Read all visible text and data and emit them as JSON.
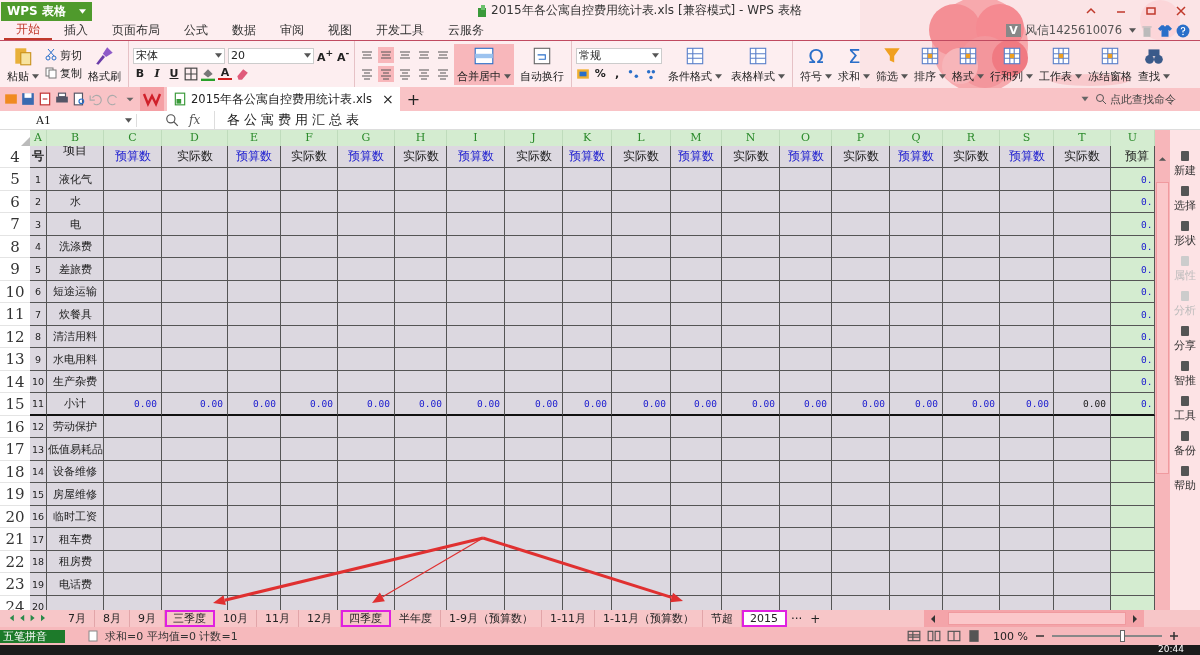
{
  "title_bar": {
    "app_menu": "WPS 表格",
    "document_title": "2015年各公寓自控费用统计表.xls [兼容模式] - WPS 表格",
    "account_badge": "V",
    "account": "风信1425610076"
  },
  "menu_tabs": [
    {
      "label": "开始",
      "selected": true
    },
    {
      "label": "插入",
      "selected": false
    },
    {
      "label": "页面布局",
      "selected": false
    },
    {
      "label": "公式",
      "selected": false
    },
    {
      "label": "数据",
      "selected": false
    },
    {
      "label": "审阅",
      "selected": false
    },
    {
      "label": "视图",
      "selected": false
    },
    {
      "label": "开发工具",
      "selected": false
    },
    {
      "label": "云服务",
      "selected": false
    }
  ],
  "ribbon": {
    "paste": "粘贴",
    "cut": "剪切",
    "copy": "复制",
    "format_painter": "格式刷",
    "font_name": "宋体",
    "font_size": "20",
    "font_resize": [
      "A$^{+}$",
      "A$^{-}$"
    ],
    "font_styles": [
      "B",
      "I",
      "U"
    ],
    "font_color": "A",
    "align_top": [
      {
        "selected": false
      },
      {
        "selected": true
      },
      {
        "selected": false
      },
      {
        "selected": false
      },
      {
        "selected": false
      }
    ],
    "align_bottom": [
      {
        "selected": false
      },
      {
        "selected": true
      },
      {
        "selected": false
      },
      {
        "selected": false
      },
      {
        "selected": false
      }
    ],
    "merge": {
      "label": "合并居中",
      "selected": true
    },
    "wrap": "自动换行",
    "number_format": "常规",
    "number_symbols": [
      "%",
      ","
    ],
    "styles": [
      "条件格式",
      "表格样式"
    ],
    "tools": [
      {
        "label": "符号",
        "glyph": "Ω",
        "dropdown": true
      },
      {
        "label": "求和",
        "glyph": "Σ",
        "dropdown": true
      },
      {
        "label": "筛选",
        "dropdown": true
      },
      {
        "label": "排序",
        "dropdown": true
      },
      {
        "label": "格式",
        "dropdown": true
      },
      {
        "label": "行和列",
        "dropdown": true
      },
      {
        "label": "工作表",
        "dropdown": true
      },
      {
        "label": "冻结窗格",
        "dropdown": false
      },
      {
        "label": "查找",
        "dropdown": true
      }
    ]
  },
  "quick_bar": {
    "document_tab": "2015年各公寓自控费用统计表.xls",
    "close": "×",
    "add": "+",
    "command_search": "点此查找命令"
  },
  "formula_bar": {
    "cell": "A1",
    "fx": "fx",
    "content": "各 公 寓 费 用 汇 总 表"
  },
  "sheet": {
    "columns": [
      "A",
      "B",
      "C",
      "D",
      "E",
      "F",
      "G",
      "H",
      "I",
      "J",
      "K",
      "L",
      "M",
      "N",
      "O",
      "P",
      "Q",
      "R",
      "S",
      "T",
      "U"
    ],
    "header_row": {
      "number": "4",
      "seq": "号",
      "item": "项目",
      "u": "预算",
      "cells": [
        {
          "text": "预算数",
          "kind": "budget"
        },
        {
          "text": "实际数",
          "kind": "actual"
        },
        {
          "text": "预算数",
          "kind": "budget"
        },
        {
          "text": "实际数",
          "kind": "actual"
        },
        {
          "text": "预算数",
          "kind": "budget"
        },
        {
          "text": "实际数",
          "kind": "actual"
        },
        {
          "text": "预算数",
          "kind": "budget"
        },
        {
          "text": "实际数",
          "kind": "actual"
        },
        {
          "text": "预算数",
          "kind": "budget"
        },
        {
          "text": "实际数",
          "kind": "actual"
        },
        {
          "text": "预算数",
          "kind": "budget"
        },
        {
          "text": "实际数",
          "kind": "actual"
        },
        {
          "text": "预算数",
          "kind": "budget"
        },
        {
          "text": "实际数",
          "kind": "actual"
        },
        {
          "text": "预算数",
          "kind": "budget"
        },
        {
          "text": "实际数",
          "kind": "actual"
        },
        {
          "text": "预算数",
          "kind": "budget"
        },
        {
          "text": "实际数",
          "kind": "actual"
        }
      ]
    },
    "rows": [
      {
        "number": "5",
        "seq": "1",
        "item": "液化气",
        "u": "0."
      },
      {
        "number": "6",
        "seq": "2",
        "item": "水",
        "u": "0."
      },
      {
        "number": "7",
        "seq": "3",
        "item": "电",
        "u": "0."
      },
      {
        "number": "8",
        "seq": "4",
        "item": "洗涤费",
        "u": "0."
      },
      {
        "number": "9",
        "seq": "5",
        "item": "差旅费",
        "u": "0."
      },
      {
        "number": "10",
        "seq": "6",
        "item": "短途运输",
        "u": "0."
      },
      {
        "number": "11",
        "seq": "7",
        "item": "炊餐具",
        "u": "0."
      },
      {
        "number": "12",
        "seq": "8",
        "item": "清洁用料",
        "u": "0."
      },
      {
        "number": "13",
        "seq": "9",
        "item": "水电用料",
        "u": "0."
      },
      {
        "number": "14",
        "seq": "10",
        "item": "生产杂费",
        "u": "0."
      },
      {
        "number": "15",
        "seq": "11",
        "item": "小计",
        "u": "0.",
        "total": true,
        "cells": [
          {
            "text": "0.00",
            "kind": "computed"
          },
          {
            "text": "0.00",
            "kind": "computed"
          },
          {
            "text": "0.00",
            "kind": "computed"
          },
          {
            "text": "0.00",
            "kind": "computed"
          },
          {
            "text": "0.00",
            "kind": "computed"
          },
          {
            "text": "0.00",
            "kind": "computed"
          },
          {
            "text": "0.00",
            "kind": "computed"
          },
          {
            "text": "0.00",
            "kind": "computed"
          },
          {
            "text": "0.00",
            "kind": "computed"
          },
          {
            "text": "0.00",
            "kind": "computed"
          },
          {
            "text": "0.00",
            "kind": "computed"
          },
          {
            "text": "0.00",
            "kind": "computed"
          },
          {
            "text": "0.00",
            "kind": "computed"
          },
          {
            "text": "0.00",
            "kind": "computed"
          },
          {
            "text": "0.00",
            "kind": "computed"
          },
          {
            "text": "0.00",
            "kind": "computed"
          },
          {
            "text": "0.00",
            "kind": "computed"
          },
          {
            "text": "0.00",
            "kind": "plain"
          }
        ]
      },
      {
        "number": "16",
        "seq": "12",
        "item": "劳动保护"
      },
      {
        "number": "17",
        "seq": "13",
        "item": "低值易耗品"
      },
      {
        "number": "18",
        "seq": "14",
        "item": "设备维修"
      },
      {
        "number": "19",
        "seq": "15",
        "item": "房屋维修"
      },
      {
        "number": "20",
        "seq": "16",
        "item": "临时工资"
      },
      {
        "number": "21",
        "seq": "17",
        "item": "租车费"
      },
      {
        "number": "22",
        "seq": "18",
        "item": "租房费"
      },
      {
        "number": "23",
        "seq": "19",
        "item": "电话费"
      },
      {
        "number": "24",
        "seq": "20"
      }
    ]
  },
  "sheet_tabs": [
    {
      "label": "7月",
      "selected": false,
      "marked": false
    },
    {
      "label": "8月",
      "selected": false,
      "marked": false
    },
    {
      "label": "9月",
      "selected": false,
      "marked": false
    },
    {
      "label": "三季度",
      "selected": false,
      "marked": true
    },
    {
      "label": "10月",
      "selected": false,
      "marked": false
    },
    {
      "label": "11月",
      "selected": false,
      "marked": false
    },
    {
      "label": "12月",
      "selected": false,
      "marked": false
    },
    {
      "label": "四季度",
      "selected": false,
      "marked": true
    },
    {
      "label": "半年度",
      "selected": false,
      "marked": false
    },
    {
      "label": "1-9月（预算数）",
      "selected": false,
      "marked": false
    },
    {
      "label": "1-11月",
      "selected": false,
      "marked": false
    },
    {
      "label": "1-11月（预算数）",
      "selected": false,
      "marked": false
    },
    {
      "label": "节超",
      "selected": false,
      "marked": false
    },
    {
      "label": "2015",
      "selected": true,
      "marked": true
    }
  ],
  "sheet_tab_more": "···",
  "sheet_tab_add": "+",
  "status_bar": {
    "input_method": "五笔拼音",
    "summary": "求和=0 平均值=0 计数=1",
    "zoom": "100 %",
    "zoom_slider": {
      "level": 0.64
    }
  },
  "side_panel": [
    {
      "label": "新建",
      "disabled": false
    },
    {
      "label": "选择",
      "disabled": false
    },
    {
      "label": "形状",
      "disabled": false
    },
    {
      "label": "属性",
      "disabled": true
    },
    {
      "label": "分析",
      "disabled": true
    },
    {
      "label": "分享",
      "disabled": false
    },
    {
      "label": "智推",
      "disabled": false
    },
    {
      "label": "工具",
      "disabled": false
    },
    {
      "label": "备份",
      "disabled": false
    },
    {
      "label": "帮助",
      "disabled": false
    }
  ],
  "taskbar": {
    "time": "20:44"
  }
}
